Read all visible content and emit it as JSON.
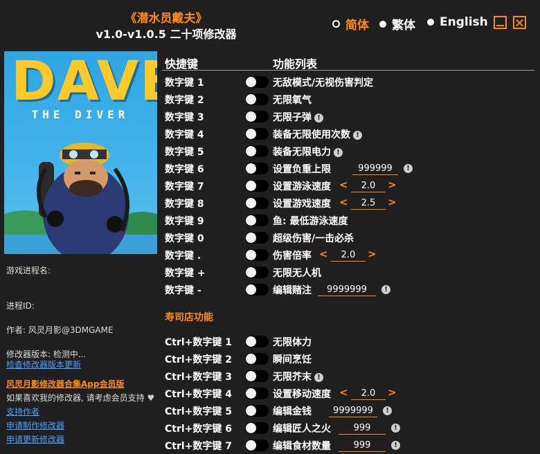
{
  "header": {
    "title": "《潜水员戴夫》",
    "subtitle": "v1.0-v1.0.5 二十项修改器"
  },
  "languages": [
    {
      "label": "简体",
      "selected": true
    },
    {
      "label": "繁体",
      "selected": false
    },
    {
      "label": "English",
      "selected": false
    }
  ],
  "window_controls": {
    "minimize_icon": "minimize-icon",
    "close_icon": "close-icon",
    "color": "#ff8c1a"
  },
  "cover": {
    "logo_text": "DAVE",
    "logo_subtext": "THE DIVER"
  },
  "info": {
    "process_name_label": "游戏进程名:",
    "process_id_label": "进程ID:",
    "author": "作者: 风灵月影@3DMGAME",
    "version": "修改器版本: 检测中...",
    "check_update_link": "检查修改器版本更新",
    "promo_link": "风灵月影修改器合集App会员版",
    "support_text": "如果喜欢我的修改器, 请考虑会员支持",
    "support_link": "支持作者",
    "request_make_link": "申请制作修改器",
    "request_update_link": "申请更新修改器"
  },
  "columns": {
    "hotkey": "快捷键",
    "features": "功能列表"
  },
  "section_sushi": "寿司店功能",
  "accent_color": "#ff8c1a",
  "link_color": "#4aa0ff",
  "rows": [
    {
      "key": "数字键 1",
      "label": "无敌模式/无视伤害判定"
    },
    {
      "key": "数字键 2",
      "label": "无限氧气"
    },
    {
      "key": "数字键 3",
      "label": "无限子弹",
      "warn": "!"
    },
    {
      "key": "数字键 4",
      "label": "装备无限使用次数",
      "warn": "!"
    },
    {
      "key": "数字键 5",
      "label": "装备无限电力",
      "warn": "!"
    },
    {
      "key": "数字键 6",
      "label": "设置负重上限",
      "value": "999999",
      "warn": "!"
    },
    {
      "key": "数字键 7",
      "label": "设置游泳速度",
      "left": "<",
      "value": "2.0",
      "right": ">"
    },
    {
      "key": "数字键 8",
      "label": "设置游戏速度",
      "left": "<",
      "value": "2.5",
      "right": ">"
    },
    {
      "key": "数字键 9",
      "label": "鱼: 最低游泳速度"
    },
    {
      "key": "数字键 0",
      "label": "超级伤害/一击必杀"
    },
    {
      "key": "数字键 .",
      "label": "伤害倍率",
      "left": "<",
      "value": "2.0",
      "right": ">"
    },
    {
      "key": "数字键 +",
      "label": "无限无人机"
    },
    {
      "key": "数字键 -",
      "label": "编辑赌注",
      "value": "9999999",
      "warn": "!"
    }
  ],
  "sushi_rows": [
    {
      "key": "Ctrl+数字键 1",
      "label": "无限体力"
    },
    {
      "key": "Ctrl+数字键 2",
      "label": "瞬间烹饪"
    },
    {
      "key": "Ctrl+数字键 3",
      "label": "无限芥末",
      "warn": "!"
    },
    {
      "key": "Ctrl+数字键 4",
      "label": "设置移动速度",
      "left": "<",
      "value": "2.0",
      "right": ">"
    },
    {
      "key": "Ctrl+数字键 5",
      "label": "编辑金钱",
      "value": "9999999",
      "warn": "!"
    },
    {
      "key": "Ctrl+数字键 6",
      "label": "编辑匠人之火",
      "value": "999",
      "warn": "!"
    },
    {
      "key": "Ctrl+数字键 7",
      "label": "编辑食材数量",
      "value": "999",
      "warn": "!"
    }
  ]
}
